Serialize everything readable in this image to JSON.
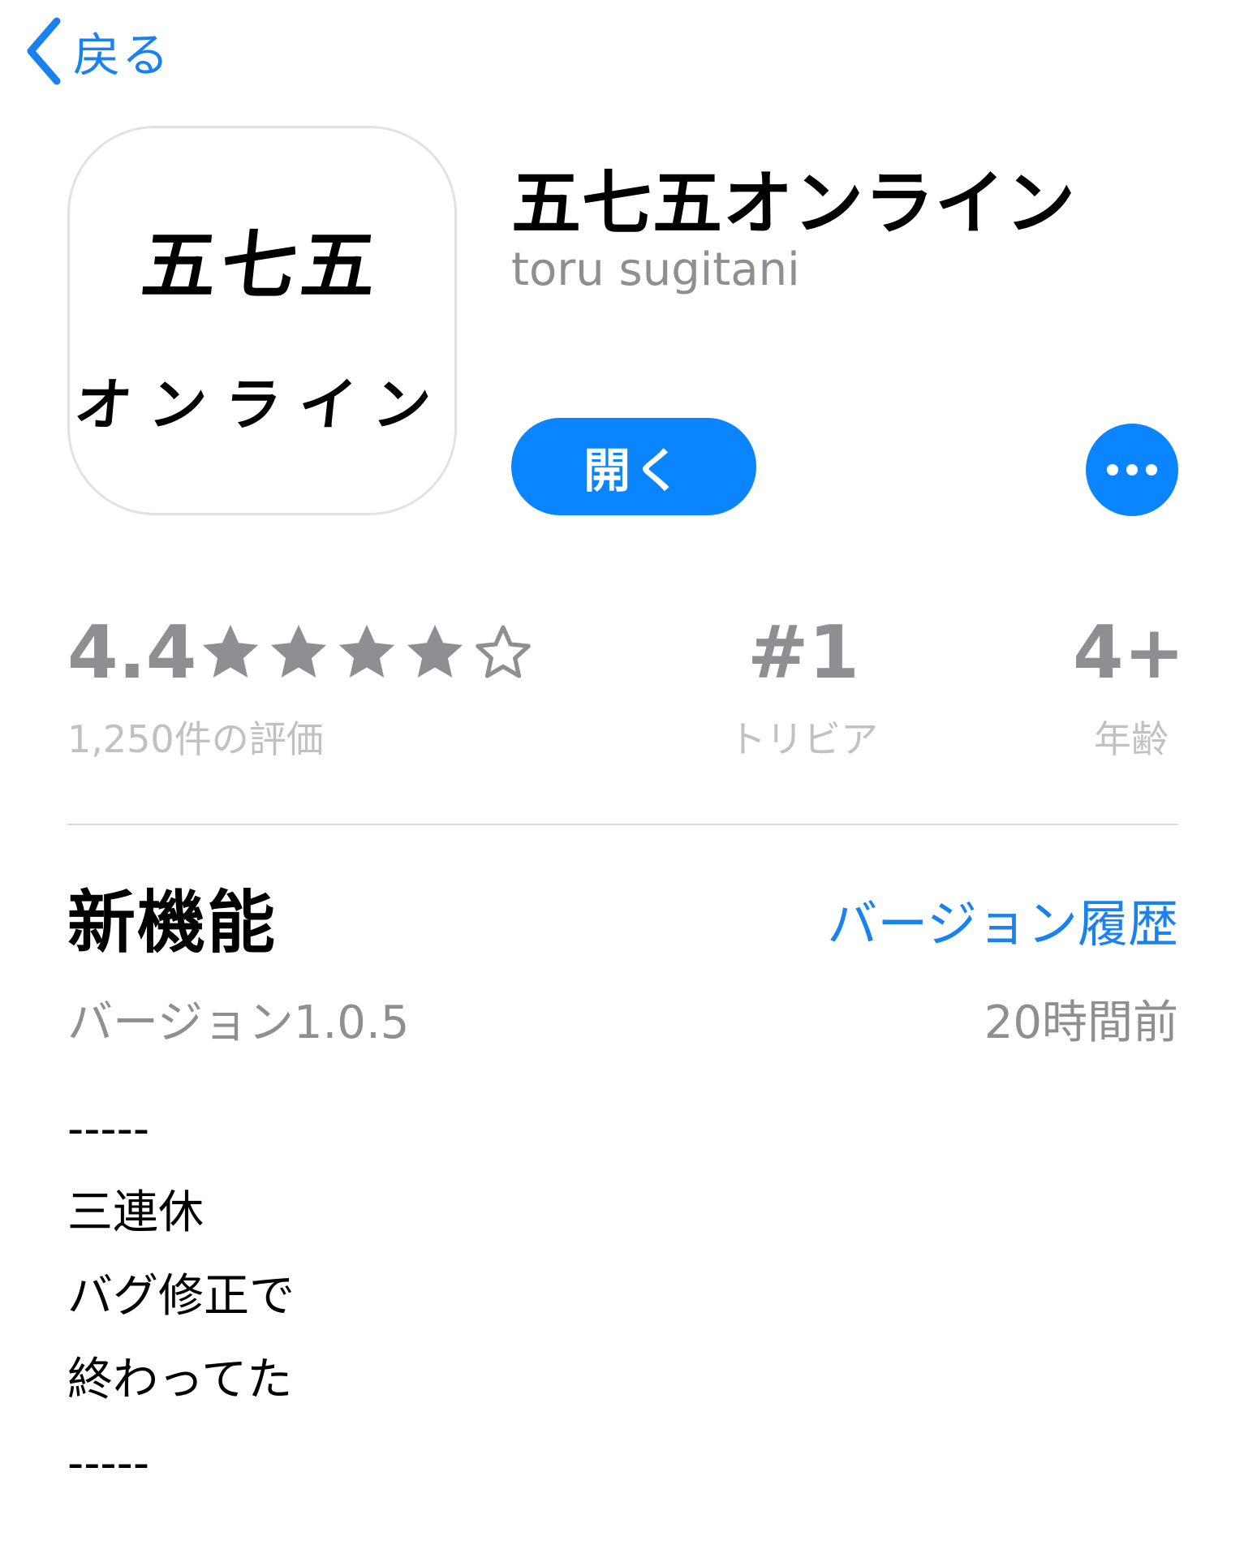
{
  "nav": {
    "back_label": "戻る"
  },
  "app": {
    "icon_line1": "五七五",
    "icon_line2": "オンライン",
    "title": "五七五オンライン",
    "developer": "toru sugitani",
    "open_label": "開く",
    "more_icon": "ellipsis-icon"
  },
  "ratings": {
    "value": "4.4",
    "stars": 4.4,
    "count_label": "1,250件の評価",
    "rank_value": "#1",
    "rank_label": "トリビア",
    "age_value": "4+",
    "age_label": "年齢"
  },
  "whats_new": {
    "title": "新機能",
    "history_link": "バージョン履歴",
    "version": "バージョン1.0.5",
    "time_ago": "20時間前",
    "notes": [
      "-----",
      "三連休",
      "バグ修正で",
      "終わってた",
      "-----"
    ]
  },
  "colors": {
    "accent": "#0a84ff",
    "link": "#1a82f0",
    "secondary_text": "#8e8e93",
    "tertiary_text": "#c0c0c5"
  }
}
